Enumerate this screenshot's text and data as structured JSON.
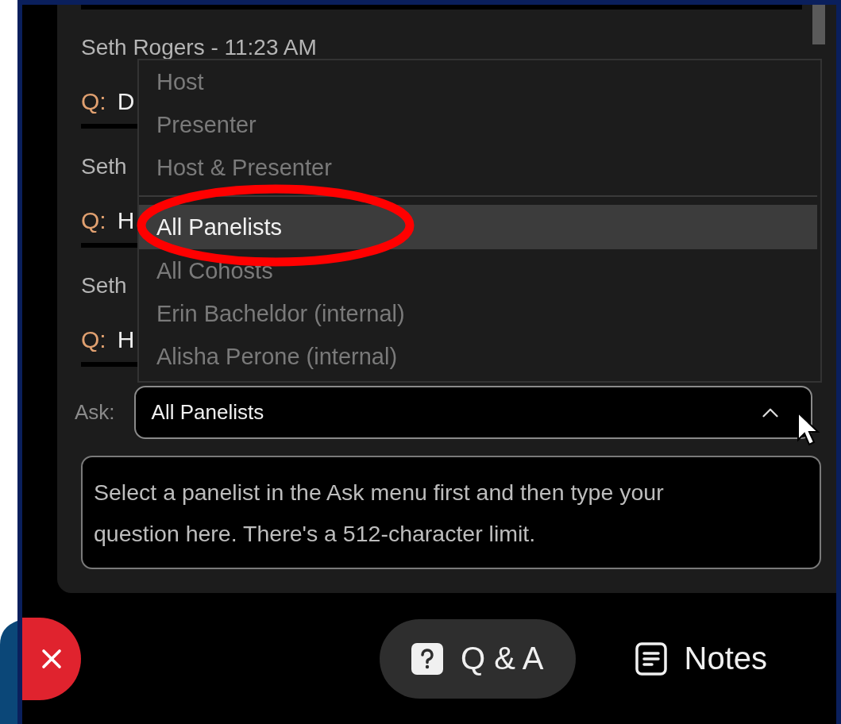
{
  "questions": [
    {
      "author": "Seth Rogers - 11:23 AM",
      "marker": "Q:",
      "text": "D"
    },
    {
      "author": "Seth",
      "marker": "Q:",
      "text": "H"
    },
    {
      "author": "Seth",
      "marker": "Q:",
      "text": "H"
    }
  ],
  "menu": {
    "items": [
      {
        "label": "Host",
        "selected": false
      },
      {
        "label": "Presenter",
        "selected": false
      },
      {
        "label": "Host & Presenter",
        "selected": false
      },
      {
        "label": "All Panelists",
        "selected": true,
        "divider_before": true,
        "circled": true
      },
      {
        "label": "All Cohosts",
        "selected": false
      },
      {
        "label": "Erin Bacheldor (internal)",
        "selected": false
      },
      {
        "label": "Alisha Perone (internal)",
        "selected": false
      }
    ]
  },
  "ask": {
    "label": "Ask:",
    "value": "All Panelists",
    "expanded": true
  },
  "question_field": {
    "placeholder": "Select a panelist in the Ask menu first and then type your question here. There's a 512-character limit."
  },
  "bottom_bar": {
    "buttons": [
      {
        "kind": "close"
      },
      {
        "kind": "qa",
        "label": "Q & A",
        "selected": true
      },
      {
        "kind": "notes",
        "label": "Notes",
        "selected": false
      }
    ]
  }
}
